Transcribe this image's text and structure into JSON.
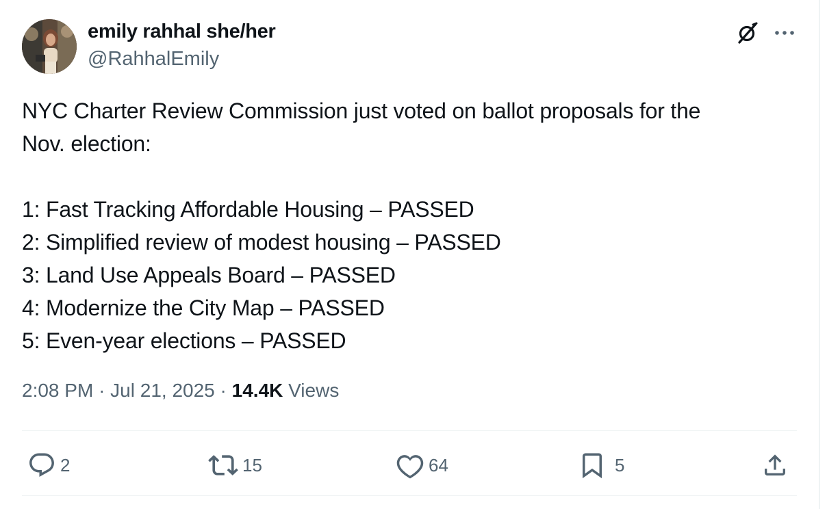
{
  "author": {
    "display_name": "emily rahhal she/her",
    "handle": "@RahhalEmily"
  },
  "header_icons": {
    "grok": "grok-icon",
    "more": "more-icon"
  },
  "tweet": {
    "lines": [
      "NYC Charter Review Commission just voted on ballot proposals for the",
      "Nov. election:",
      "",
      "1: Fast Tracking Affordable Housing – PASSED",
      "2: Simplified review of modest housing – PASSED",
      "3: Land Use Appeals Board – PASSED",
      "4: Modernize the City Map – PASSED",
      "5: Even-year elections – PASSED"
    ]
  },
  "meta": {
    "time": "2:08 PM",
    "separator": "·",
    "date": "Jul 21, 2025",
    "views_count": "14.4K",
    "views_label": "Views"
  },
  "actions": {
    "replies": {
      "icon": "reply-icon",
      "count": "2"
    },
    "reposts": {
      "icon": "repost-icon",
      "count": "15"
    },
    "likes": {
      "icon": "heart-icon",
      "count": "64"
    },
    "bookmarks": {
      "icon": "bookmark-icon",
      "count": "5"
    },
    "share": {
      "icon": "share-icon"
    }
  },
  "colors": {
    "text_primary": "#0f1419",
    "text_secondary": "#536471",
    "divider": "#eff3f4"
  }
}
